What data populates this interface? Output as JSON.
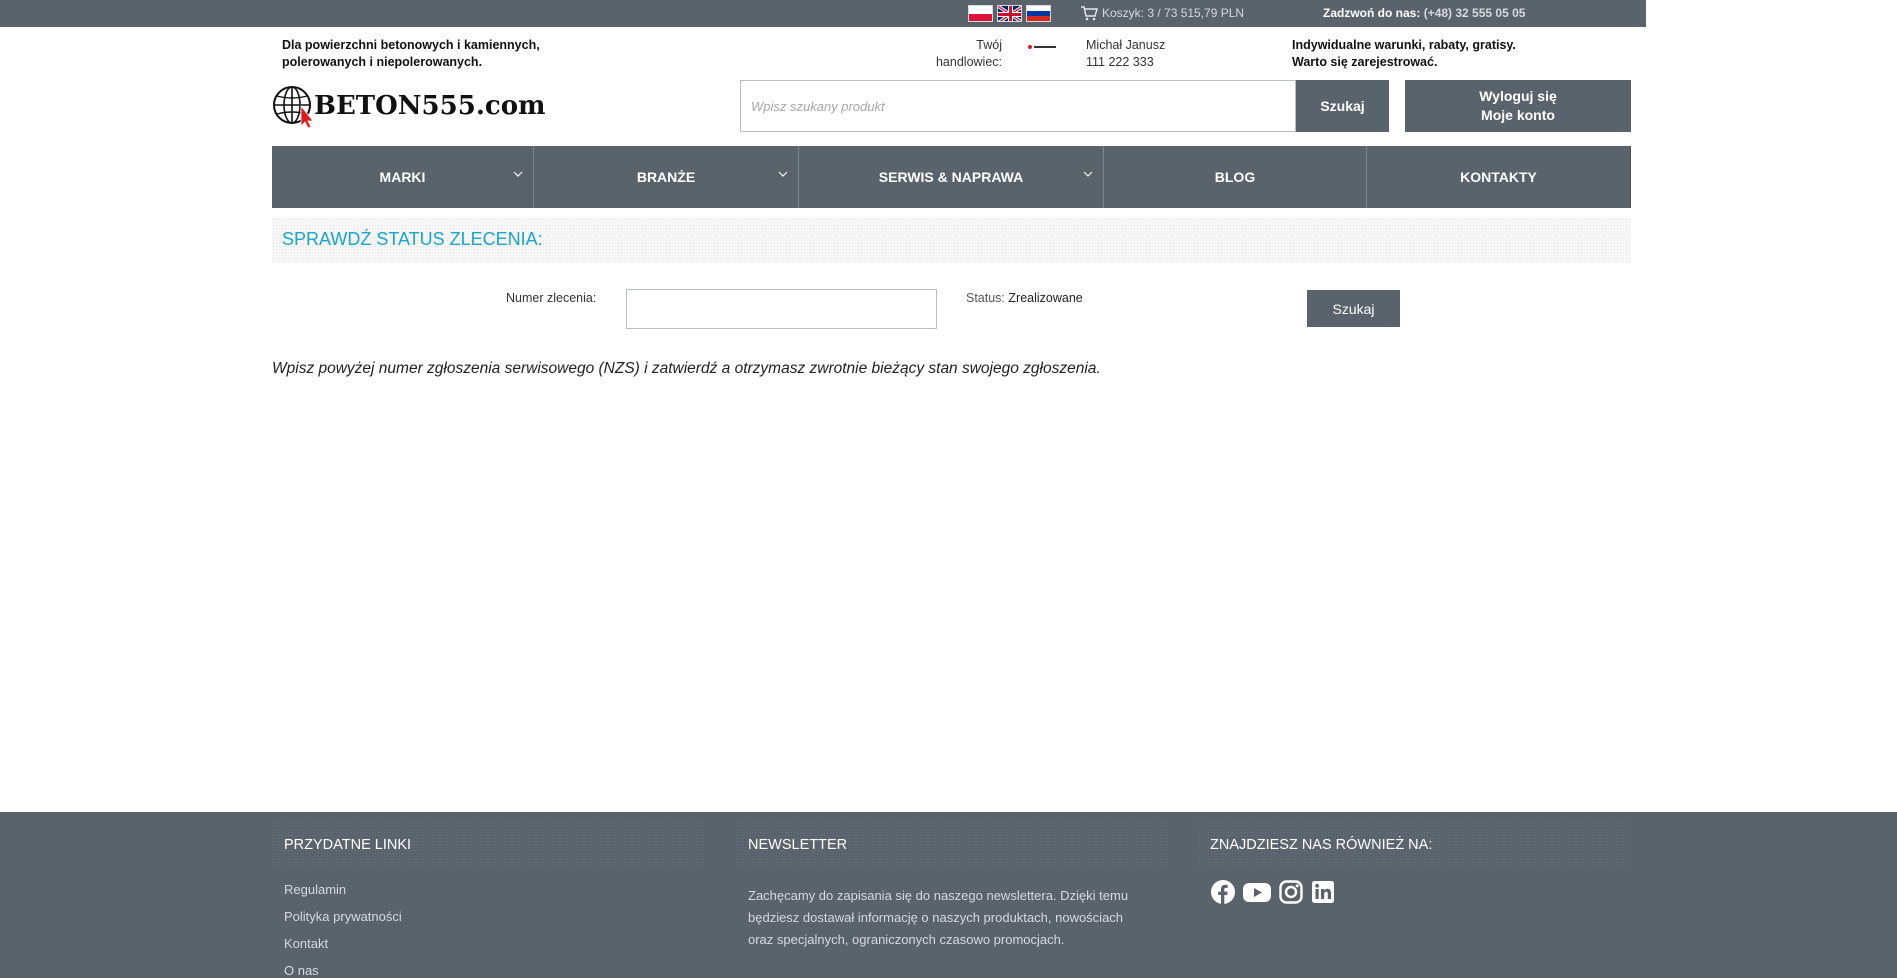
{
  "topbar": {
    "flags": [
      "flag-pl-icon",
      "flag-gb-icon",
      "flag-ru-icon"
    ],
    "cart_text": "Koszyk: 3 / 73 515,79 PLN",
    "phone_label": "Zadzwoń do nas:",
    "phone_number": "(+48) 32 555 05 05"
  },
  "header": {
    "tagline_line1": "Dla powierzchni betonowych i kamiennych,",
    "tagline_line2": "polerowanych i niepolerowanych.",
    "logo_text": "BETON555.com",
    "rep_label_line1": "Twój",
    "rep_label_line2": "handlowiec:",
    "rep_name": "Michał Janusz",
    "rep_phone": "111 222 333",
    "promo_line1": "Indywidualne warunki, rabaty, gratisy.",
    "promo_line2": "Warto się zarejestrować."
  },
  "search": {
    "placeholder": "Wpisz szukany produkt",
    "value": "",
    "button_label": "Szukaj"
  },
  "account": {
    "logout_label": "Wyloguj się",
    "my_account_label": "Moje konto"
  },
  "nav": {
    "items": [
      {
        "label": "MARKI",
        "has_dropdown": true
      },
      {
        "label": "BRANŻE",
        "has_dropdown": true
      },
      {
        "label": "SERWIS & NAPRAWA",
        "has_dropdown": true
      },
      {
        "label": "BLOG",
        "has_dropdown": false
      },
      {
        "label": "KONTAKTY",
        "has_dropdown": false
      }
    ]
  },
  "status_check": {
    "title": "SPRAWDŹ STATUS ZLECENIA:",
    "number_label": "Numer zlecenia:",
    "number_value": "",
    "status_label": "Status:",
    "status_value": "Zrealizowane",
    "button_label": "Szukaj",
    "hint": "Wpisz powyżej numer zgłoszenia serwisowego (NZS) i zatwierdź a otrzymasz zwrotnie bieżący stan swojego zgłoszenia."
  },
  "footer": {
    "links_title": "PRZYDATNE LINKI",
    "links": [
      "Regulamin",
      "Polityka prywatności",
      "Kontakt",
      "O nas"
    ],
    "newsletter_title": "NEWSLETTER",
    "newsletter_text": "Zachęcamy do zapisania się do naszego newslettera. Dzięki temu będziesz dostawał informację o naszych produktach, nowościach oraz specjalnych, ograniczonych czasowo promocjach.",
    "social_title": "ZNAJDZIESZ NAS RÓWNIEŻ NA:",
    "social_icons": [
      "facebook-icon",
      "youtube-icon",
      "instagram-icon",
      "linkedin-icon"
    ]
  },
  "colors": {
    "bar": "#5a626c",
    "accent": "#1aa6c7",
    "text": "#222222"
  }
}
